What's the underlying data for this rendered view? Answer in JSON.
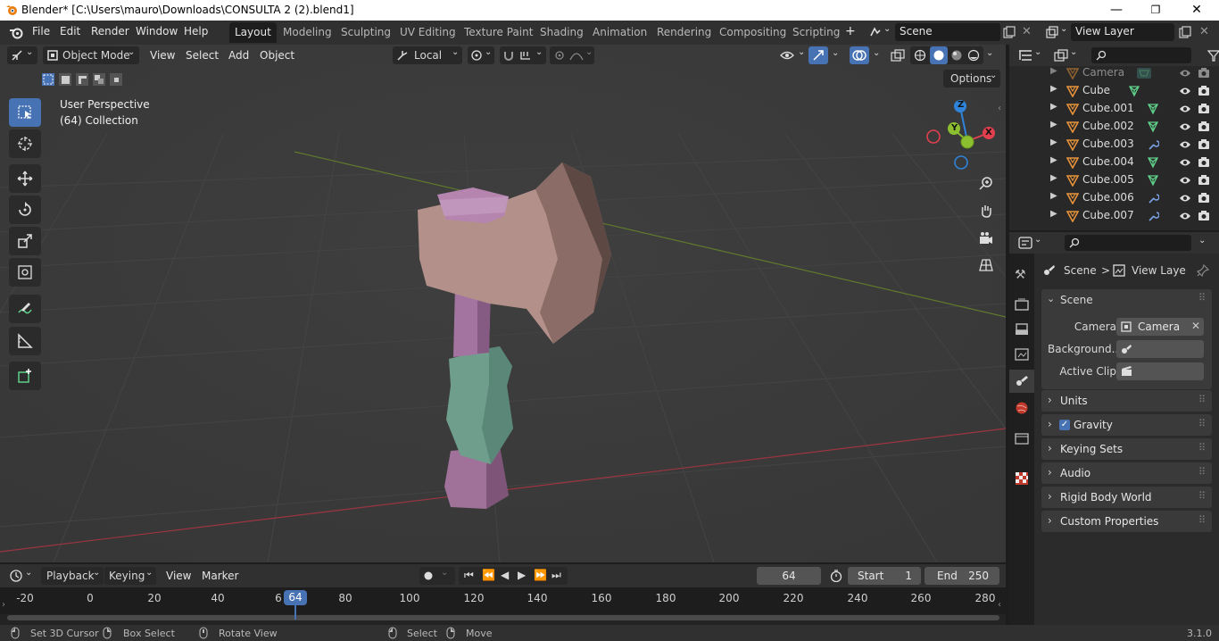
{
  "window": {
    "title": "Blender* [C:\\Users\\mauro\\Downloads\\CONSULTA 2 (2).blend1]",
    "minimize": "—",
    "maximize": "❐",
    "close": "✕"
  },
  "menubar": {
    "items": [
      "File",
      "Edit",
      "Render",
      "Window",
      "Help"
    ],
    "workspaces": [
      "Layout",
      "Modeling",
      "Sculpting",
      "UV Editing",
      "Texture Paint",
      "Shading",
      "Animation",
      "Rendering",
      "Compositing",
      "Scripting"
    ],
    "active_workspace": "Layout",
    "add_workspace": "+",
    "scene_name": "Scene",
    "view_layer_name": "View Layer"
  },
  "viewport": {
    "mode": "Object Mode",
    "menus": [
      "View",
      "Select",
      "Add",
      "Object"
    ],
    "transform_orientation": "Local",
    "options_label": "Options",
    "overlay_line1": "User Perspective",
    "overlay_line2": "(64) Collection",
    "gizmo_axes": {
      "x": "X",
      "y": "Y",
      "z": "Z"
    }
  },
  "outliner": {
    "rows": [
      {
        "name": "Camera",
        "icon": "camera-data-icon",
        "modifier": false
      },
      {
        "name": "Cube",
        "icon": "mesh-icon",
        "modifier": false
      },
      {
        "name": "Cube.001",
        "icon": "mesh-icon",
        "modifier": false
      },
      {
        "name": "Cube.002",
        "icon": "mesh-icon",
        "modifier": false
      },
      {
        "name": "Cube.003",
        "icon": "wrench-icon",
        "modifier": true
      },
      {
        "name": "Cube.004",
        "icon": "mesh-icon",
        "modifier": false
      },
      {
        "name": "Cube.005",
        "icon": "mesh-icon",
        "modifier": false
      },
      {
        "name": "Cube.006",
        "icon": "wrench-icon",
        "modifier": true
      },
      {
        "name": "Cube.007",
        "icon": "wrench-icon",
        "modifier": true
      }
    ]
  },
  "properties": {
    "breadcrumb_scene": "Scene",
    "breadcrumb_sep": ">",
    "breadcrumb_layer": "View Laye",
    "scene_panel": "Scene",
    "camera_label": "Camera",
    "camera_value": "Camera",
    "background_label": "Background...",
    "active_clip_label": "Active Clip",
    "panels": [
      "Units",
      "Gravity",
      "Keying Sets",
      "Audio",
      "Rigid Body World",
      "Custom Properties"
    ],
    "gravity_checked": true
  },
  "timeline": {
    "menus": [
      "Playback",
      "Keying",
      "View",
      "Marker"
    ],
    "current_frame": "64",
    "start_label": "Start",
    "start_value": "1",
    "end_label": "End",
    "end_value": "250",
    "ticks": [
      "-20",
      "0",
      "20",
      "40",
      "6",
      "80",
      "100",
      "120",
      "140",
      "160",
      "180",
      "200",
      "220",
      "240",
      "260",
      "280"
    ],
    "playhead_label": "64"
  },
  "statusbar": {
    "set_cursor": "Set 3D Cursor",
    "box_select": "Box Select",
    "rotate_view": "Rotate View",
    "select": "Select",
    "move": "Move",
    "version": "3.1.0"
  },
  "colors": {
    "accent": "#4772b3",
    "axis_x": "#e0404e",
    "axis_y": "#8cbf30",
    "axis_z": "#2f83d8",
    "mesh_green": "#5fcf89",
    "wrench_blue": "#7aa3e6",
    "object_orange": "#e8923a"
  }
}
